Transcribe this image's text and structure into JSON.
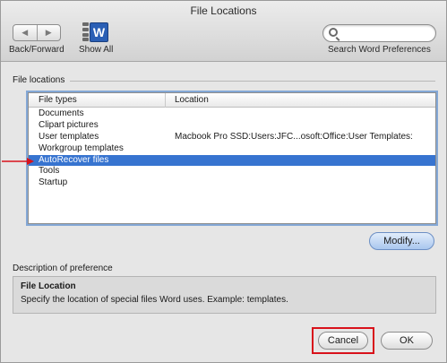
{
  "window": {
    "title": "File Locations"
  },
  "toolbar": {
    "nav_back": "◀",
    "nav_forward": "▶",
    "back_forward_label": "Back/Forward",
    "show_all_label": "Show All",
    "word_icon_letter": "W",
    "search_placeholder": "",
    "search_label": "Search Word Preferences"
  },
  "file_locations": {
    "group_label": "File locations",
    "columns": [
      "File types",
      "Location"
    ],
    "rows": [
      {
        "type": "Documents",
        "location": ""
      },
      {
        "type": "Clipart pictures",
        "location": ""
      },
      {
        "type": "User templates",
        "location": "Macbook Pro SSD:Users:JFC...osoft:Office:User Templates:"
      },
      {
        "type": "Workgroup templates",
        "location": ""
      },
      {
        "type": "AutoRecover files",
        "location": ""
      },
      {
        "type": "Tools",
        "location": ""
      },
      {
        "type": "Startup",
        "location": ""
      }
    ],
    "selected_index": 4,
    "modify_label": "Modify..."
  },
  "description": {
    "group_label": "Description of preference",
    "title": "File Location",
    "text": "Specify the location of special files Word uses. Example: templates."
  },
  "buttons": {
    "cancel": "Cancel",
    "ok": "OK"
  },
  "colors": {
    "selection": "#3774d0",
    "highlight_box": "#d8121b",
    "arrow": "#d8121b"
  }
}
